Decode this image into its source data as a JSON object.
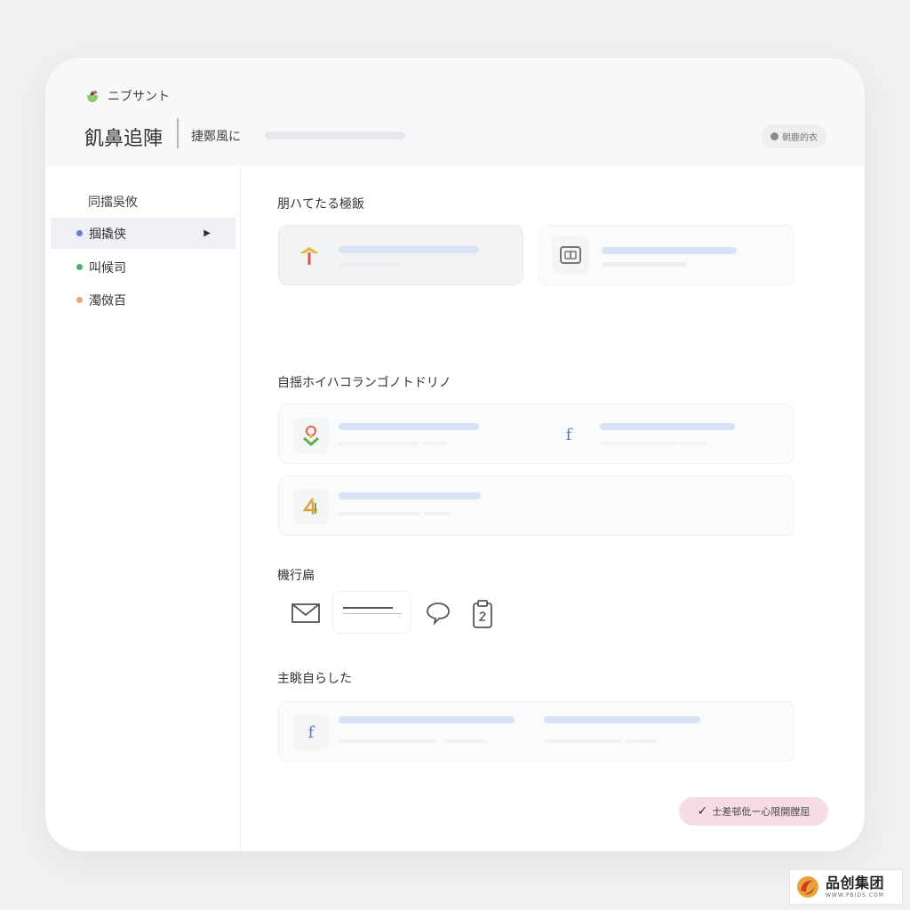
{
  "app": {
    "logo_text": "ニブサント",
    "title": "飢鼻追陣",
    "subtitle": "捷鄭風に",
    "header_pill": "朝鹿的衣"
  },
  "sidebar": {
    "heading": "同擂吳攸",
    "items": [
      {
        "label": "掴撬侠",
        "bullet_color": "#6b7be0",
        "active": true
      },
      {
        "label": "叫候司",
        "bullet_color": "#4caf68",
        "active": false
      },
      {
        "label": "濁傚百",
        "bullet_color": "#e6a57a",
        "active": false
      }
    ]
  },
  "sections": {
    "s1_title": "朋ハてたる極飯",
    "s2_title": "自揺ホイハコランゴノトドリノ",
    "s3_title": "機行扁",
    "s4_title": "主眺自らした"
  },
  "icons": {
    "s1_card1": "arrow-up-icon",
    "s1_card2": "card-icon",
    "s2_card1": "location-pin-icon",
    "s2_card2": "facebook-icon",
    "s2_card3": "number-four-icon",
    "tools": [
      "mail-icon",
      "text-card-icon",
      "chat-bubble-icon",
      "clipboard-icon"
    ],
    "s4_card": "facebook-icon"
  },
  "glyphs": {
    "facebook": "f"
  },
  "footer": {
    "action_label": "士差邨仳ー心限開膛屈",
    "check_glyph": "✓"
  },
  "watermark": {
    "main": "品创集团",
    "sub": "WWW.PBIDS.COM"
  },
  "colors": {
    "accent_blue": "#d8e3f6",
    "footer_pink": "#f7dce6"
  }
}
